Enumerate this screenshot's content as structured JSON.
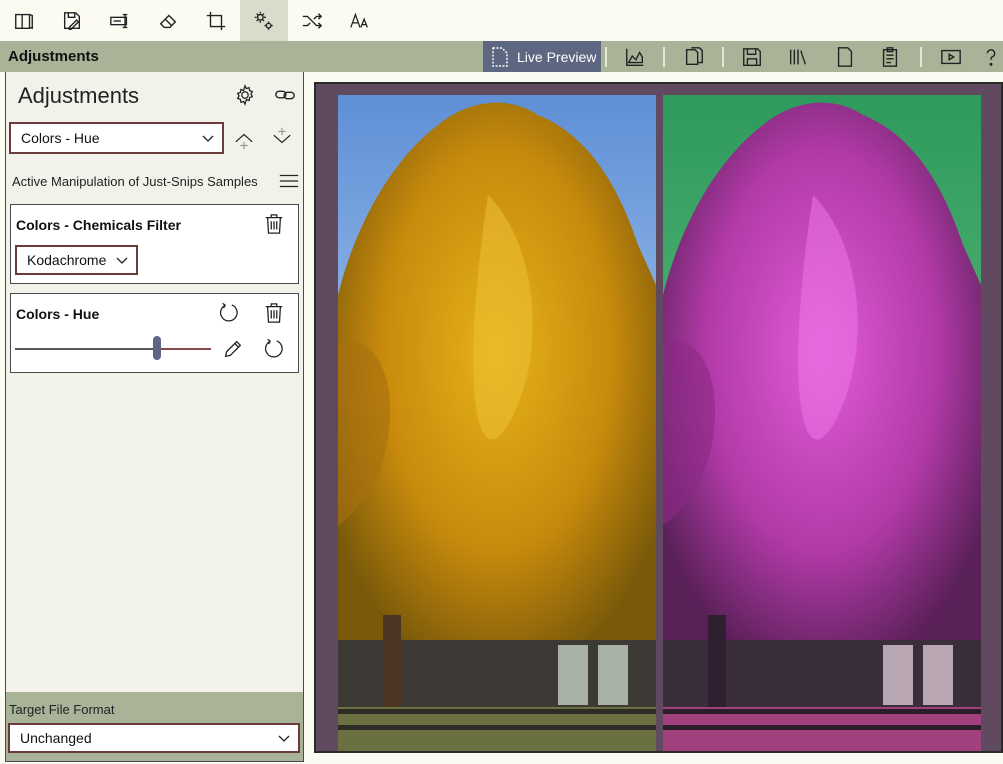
{
  "toolbar": {
    "items": [
      {
        "name": "library-icon"
      },
      {
        "name": "save-edit-icon"
      },
      {
        "name": "rename-icon"
      },
      {
        "name": "eraser-icon"
      },
      {
        "name": "crop-icon"
      },
      {
        "name": "adjustments-icon"
      },
      {
        "name": "shuffle-icon"
      },
      {
        "name": "font-size-icon"
      }
    ],
    "active_index": 5
  },
  "header": {
    "title": "Adjustments",
    "live_preview_label": "Live Preview"
  },
  "panel": {
    "title": "Adjustments",
    "selected_adjustment": "Colors - Hue",
    "manipulation_label": "Active Manipulation of Just-Snips Samples",
    "cards": [
      {
        "title": "Colors - Chemicals Filter",
        "filter_value": "Kodachrome"
      },
      {
        "title": "Colors - Hue",
        "slider_fraction": 0.72
      }
    ],
    "footer": {
      "label": "Target File Format",
      "value": "Unchanged"
    }
  },
  "colors": {
    "accent": "#5d6781",
    "header_band": "#a9b398",
    "select_border": "#6b3a3a",
    "preview_bg": "#5f4a60"
  }
}
